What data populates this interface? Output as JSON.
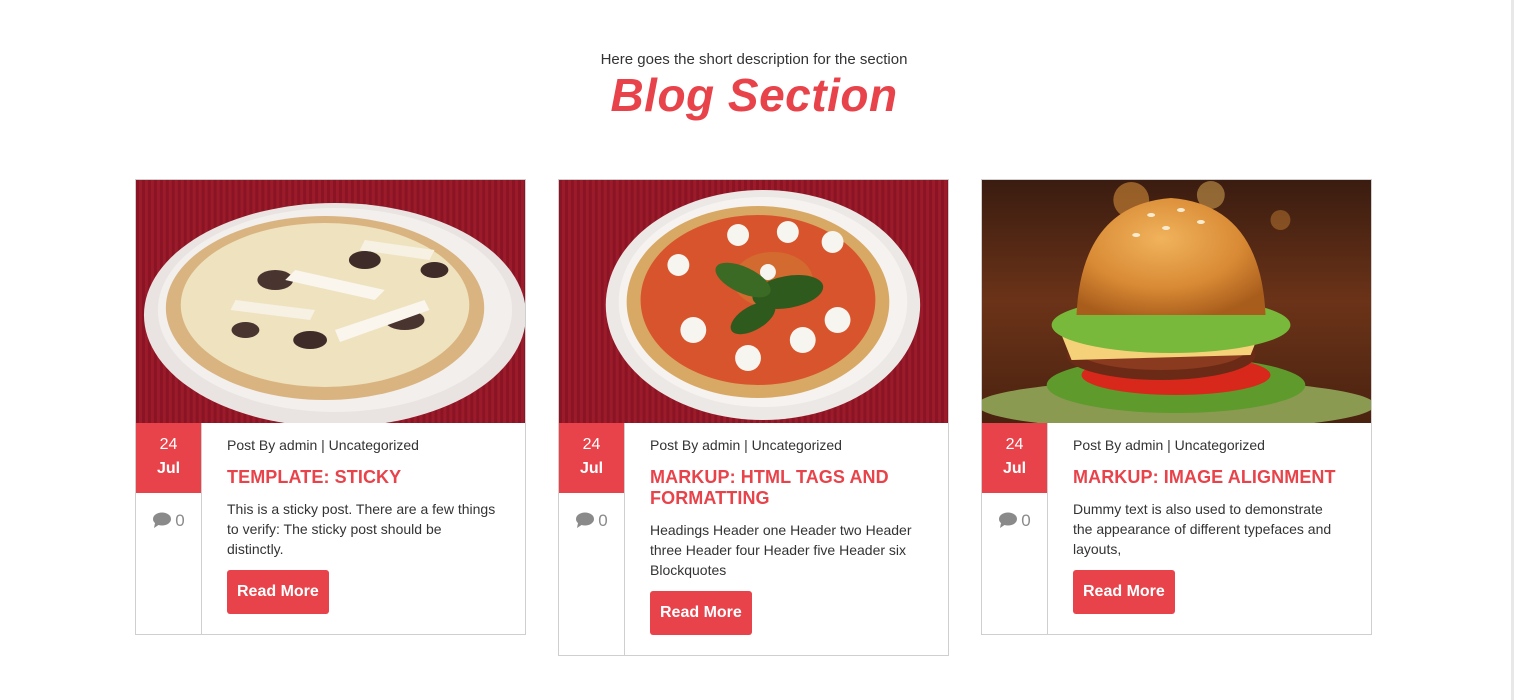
{
  "section": {
    "description": "Here goes the short description for the section",
    "title": "Blog Section"
  },
  "colors": {
    "accent": "#e8434a",
    "border": "#cfcfcf",
    "muted_icon": "#8a8a8a"
  },
  "posts": [
    {
      "image": "pizza-mushroom-photo",
      "day": "24",
      "month": "Jul",
      "comment_count": "0",
      "meta": "Post By admin | Uncategorized",
      "title": "TEMPLATE: STICKY",
      "excerpt": "This is a sticky post. There are a few things to verify: The sticky post should be distinctly.",
      "read_more": "Read More"
    },
    {
      "image": "pizza-margherita-photo",
      "day": "24",
      "month": "Jul",
      "comment_count": "0",
      "meta": "Post By admin | Uncategorized",
      "title": "MARKUP: HTML TAGS AND FORMATTING",
      "excerpt": "Headings Header one Header two Header three Header four Header five Header six Blockquotes",
      "read_more": "Read More"
    },
    {
      "image": "burger-photo",
      "day": "24",
      "month": "Jul",
      "comment_count": "0",
      "meta": "Post By admin | Uncategorized",
      "title": "MARKUP: IMAGE ALIGNMENT",
      "excerpt": "Dummy text is also used to demonstrate the appearance of different typefaces and layouts,",
      "read_more": "Read More"
    }
  ]
}
